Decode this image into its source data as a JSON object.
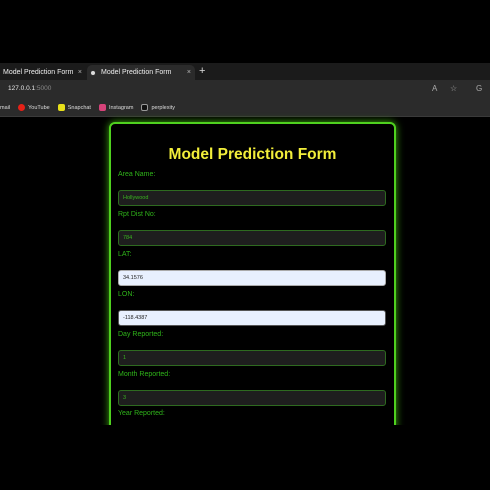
{
  "browser": {
    "tabs": [
      {
        "label": "Model Prediction Form",
        "close": "×"
      },
      {
        "label": "Model Prediction Form",
        "close": "×"
      }
    ],
    "new_tab": "+",
    "url_host": "127.0.0.1",
    "url_port": ":5000",
    "bookmarks": [
      {
        "label": "mail",
        "color": ""
      },
      {
        "label": "YouTube",
        "color": "#e62117"
      },
      {
        "label": "Snapchat",
        "color": "#e8e01a"
      },
      {
        "label": "Instagram",
        "color": "#d6437a"
      },
      {
        "label": "perplexity",
        "color": "#444"
      }
    ]
  },
  "form": {
    "title": "Model Prediction Form",
    "fields": [
      {
        "label": "Area Name:",
        "value": "Hollywood"
      },
      {
        "label": "Rpt Dist No:",
        "value": "784"
      },
      {
        "label": "LAT:",
        "value": "34.1576"
      },
      {
        "label": "LON:",
        "value": "-118.4387"
      },
      {
        "label": "Day Reported:",
        "value": "1"
      },
      {
        "label": "Month Reported:",
        "value": "3"
      },
      {
        "label": "Year Reported:",
        "value": ""
      }
    ]
  },
  "colors": {
    "accent": "#4fd11f",
    "title": "#f2ee3a",
    "label": "#2fb51a"
  }
}
